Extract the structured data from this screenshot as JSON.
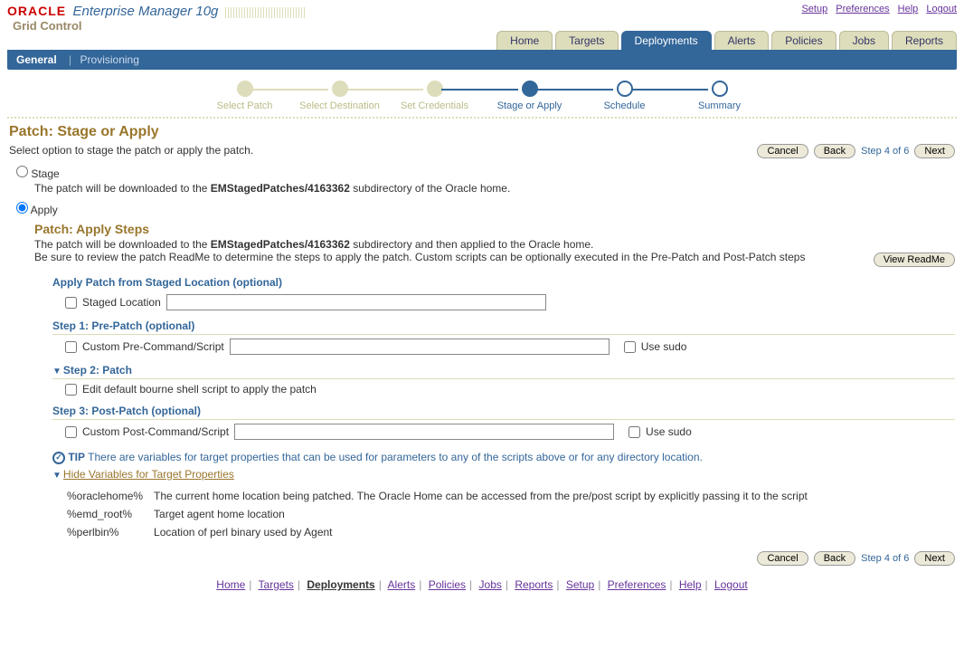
{
  "header": {
    "logo": "ORACLE",
    "product": "Enterprise Manager 10g",
    "subproduct": "Grid Control",
    "links": {
      "setup": "Setup",
      "preferences": "Preferences",
      "help": "Help",
      "logout": "Logout"
    }
  },
  "tabs": {
    "home": "Home",
    "targets": "Targets",
    "deployments": "Deployments",
    "alerts": "Alerts",
    "policies": "Policies",
    "jobs": "Jobs",
    "reports": "Reports"
  },
  "subnav": {
    "general": "General",
    "provisioning": "Provisioning"
  },
  "train": {
    "s1": "Select Patch",
    "s2": "Select Destination",
    "s3": "Set Credentials",
    "s4": "Stage or Apply",
    "s5": "Schedule",
    "s6": "Summary"
  },
  "page": {
    "title": "Patch: Stage or Apply",
    "instruction": "Select option to stage the patch or apply the patch.",
    "step_counter": "Step 4 of 6",
    "buttons": {
      "cancel": "Cancel",
      "back": "Back",
      "next": "Next"
    }
  },
  "options": {
    "stage_label": "Stage",
    "stage_desc_pre": "The patch will be downloaded to the ",
    "stage_desc_bold": "EMStagedPatches/4163362",
    "stage_desc_post": " subdirectory of the Oracle home.",
    "apply_label": "Apply"
  },
  "apply": {
    "title": "Patch: Apply Steps",
    "desc1_pre": "The patch will be downloaded to the ",
    "desc1_bold": "EMStagedPatches/4163362",
    "desc1_post": " subdirectory and then applied to the Oracle home.",
    "desc2": "Be sure to review the patch ReadMe to determine the steps to apply the patch. Custom scripts can be optionally executed in the Pre-Patch and Post-Patch steps",
    "view_readme": "View ReadMe",
    "staged_heading": "Apply Patch from Staged Location (optional)",
    "staged_label": "Staged Location",
    "step1_heading": "Step 1: Pre-Patch (optional)",
    "pre_cmd_label": "Custom Pre-Command/Script",
    "use_sudo": "Use sudo",
    "step2_heading": "Step 2: Patch",
    "edit_script_label": "Edit default bourne shell script to apply the patch",
    "step3_heading": "Step 3: Post-Patch (optional)",
    "post_cmd_label": "Custom Post-Command/Script"
  },
  "tip": {
    "label": "TIP",
    "text": "There are variables for target properties that can be used for parameters to any of the scripts above or for any directory location.",
    "hide_link": "Hide Variables for Target Properties"
  },
  "vars": {
    "v1n": "%oraclehome%",
    "v1d": "The current home location being patched. The Oracle Home can be accessed from the pre/post script by explicitly passing it to the script",
    "v2n": "%emd_root%",
    "v2d": "Target agent home location",
    "v3n": "%perlbin%",
    "v3d": "Location of perl binary used by Agent"
  },
  "footer": {
    "home": "Home",
    "targets": "Targets",
    "deployments": "Deployments",
    "alerts": "Alerts",
    "policies": "Policies",
    "jobs": "Jobs",
    "reports": "Reports",
    "setup": "Setup",
    "preferences": "Preferences",
    "help": "Help",
    "logout": "Logout"
  }
}
